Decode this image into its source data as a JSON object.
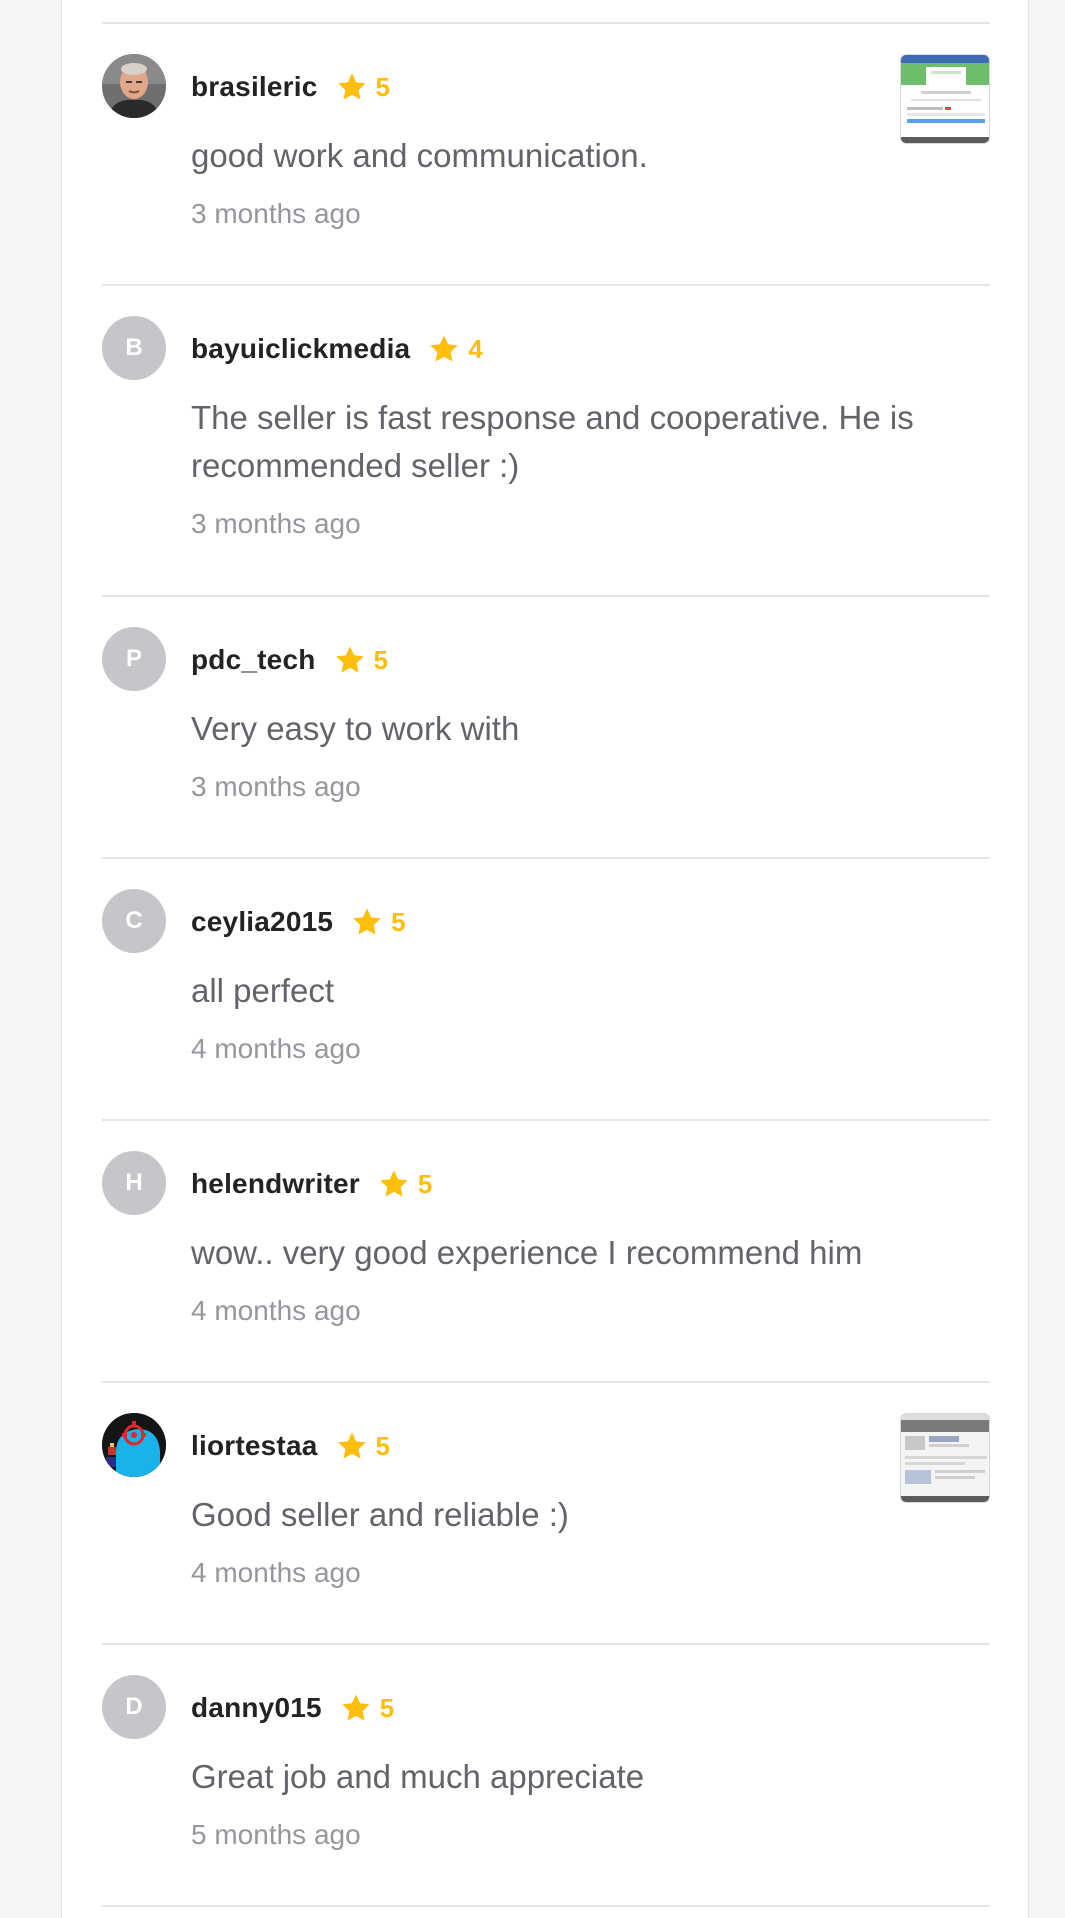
{
  "colors": {
    "star": "#ffbe0b",
    "username": "#222325",
    "body_text": "#62646a",
    "meta_text": "#95979d",
    "divider": "#e4e5e7",
    "avatar_placeholder": "#c5c6c9"
  },
  "reviews": [
    {
      "username": "brasileric",
      "rating": "5",
      "text": "good work and communication.",
      "time": "3 months ago",
      "avatar_type": "photo-man",
      "has_thumbnail": true
    },
    {
      "username": "bayuiclickmedia",
      "rating": "4",
      "text": "The seller is fast response and cooperative. He is recommended seller :)",
      "time": "3 months ago",
      "avatar_letter": "B"
    },
    {
      "username": "pdc_tech",
      "rating": "5",
      "text": "Very easy to work with",
      "time": "3 months ago",
      "avatar_letter": "P"
    },
    {
      "username": "ceylia2015",
      "rating": "5",
      "text": "all perfect",
      "time": "4 months ago",
      "avatar_letter": "C"
    },
    {
      "username": "helendwriter",
      "rating": "5",
      "text": "wow.. very good experience I recommend him",
      "time": "4 months ago",
      "avatar_letter": "H"
    },
    {
      "username": "liortestaa",
      "rating": "5",
      "text": "Good seller and reliable :)",
      "time": "4 months ago",
      "avatar_type": "photo-graphic",
      "has_thumbnail": true
    },
    {
      "username": "danny015",
      "rating": "5",
      "text": "Great job and much appreciate",
      "time": "5 months ago",
      "avatar_letter": "D"
    }
  ],
  "icons": {
    "star": "star-icon"
  }
}
